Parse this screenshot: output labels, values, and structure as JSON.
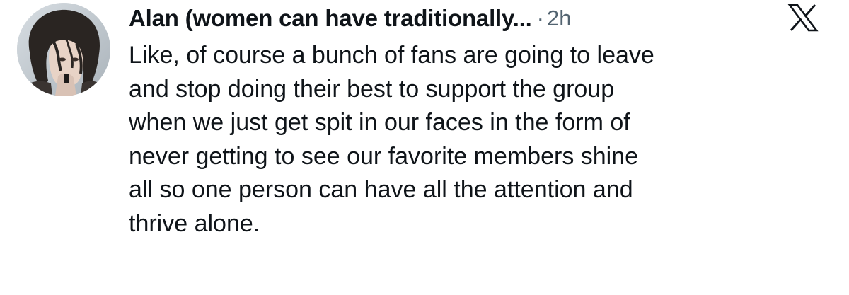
{
  "tweet": {
    "author": {
      "display_name": "Alan (women can have traditionally...",
      "avatar_icon": "profile-photo"
    },
    "separator": "·",
    "timestamp": "2h",
    "platform_icon": "x-logo-icon",
    "text_lines": [
      "Like, of course a bunch of fans are going to leave",
      "and stop doing their best to support the group",
      "when we just get spit in our faces in the form of",
      "never getting to see our favorite members shine",
      "all so one person can have all the attention and",
      "thrive alone."
    ]
  },
  "colors": {
    "text_primary": "#0f1419",
    "text_secondary": "#536471",
    "background": "#ffffff"
  }
}
